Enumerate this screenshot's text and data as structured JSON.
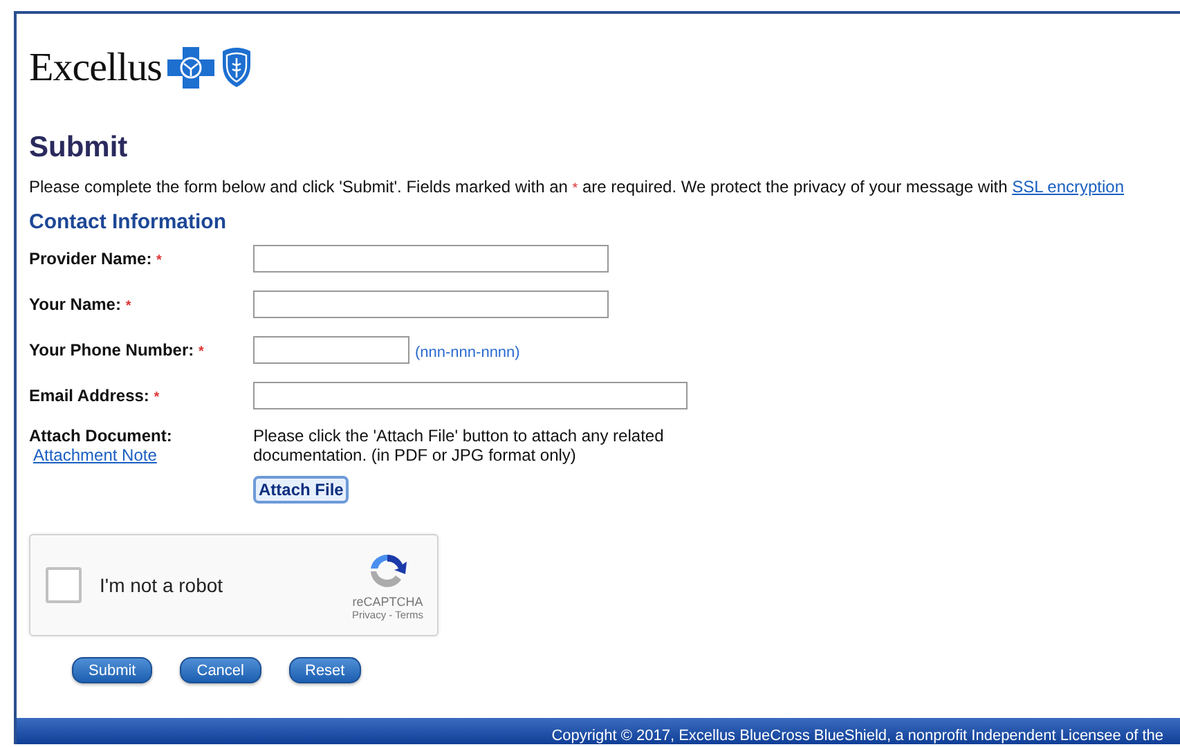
{
  "logo": {
    "wordmark": "Excellus"
  },
  "heading": "Submit",
  "intro": {
    "before": "Please complete the form below and click 'Submit'. Fields marked with an ",
    "required_mark": "*",
    "after": " are required. We protect the privacy of your message with ",
    "link": "SSL encryption"
  },
  "section_title": "Contact Information",
  "fields": [
    {
      "kind": "name",
      "label": "Provider Name:",
      "required_mark": "*"
    },
    {
      "kind": "name",
      "label": "Your Name:",
      "required_mark": "*"
    },
    {
      "kind": "phone",
      "label": "Your Phone Number:",
      "required_mark": "*",
      "hint": "(nnn-nnn-nnnn)"
    },
    {
      "kind": "email",
      "label": "Email Address:",
      "required_mark": "*"
    }
  ],
  "attach": {
    "label": "Attach Document:",
    "link": "Attachment Note",
    "description": "Please click the 'Attach File' button to attach any related documentation. (in PDF or JPG format only)",
    "button": "Attach File"
  },
  "captcha": {
    "label": "I'm not a robot",
    "checked": false,
    "brand": "reCAPTCHA",
    "privacy": "Privacy",
    "separator": "-",
    "terms": "Terms"
  },
  "buttons": [
    "Submit",
    "Cancel",
    "Reset"
  ],
  "footer": "Copyright © 2017, Excellus BlueCross BlueShield, a nonprofit Independent Licensee of the"
}
